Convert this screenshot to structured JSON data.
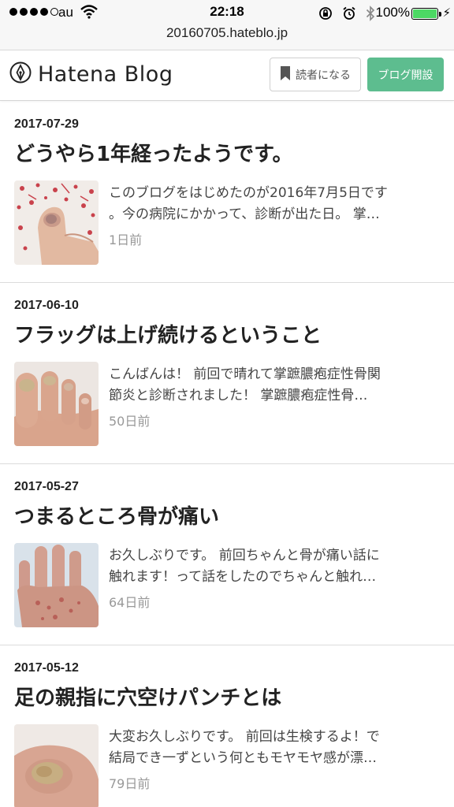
{
  "status_bar": {
    "carrier": "au",
    "time": "22:18",
    "battery_percent": "100%",
    "battery_level": 1.0,
    "battery_color": "#4cd964"
  },
  "browser": {
    "url": "20160705.hateblo.jp"
  },
  "header": {
    "logo_text": "Hatena Blog",
    "reader_button": "読者になる",
    "open_blog_button": "ブログ開設",
    "accent_color": "#5dbd8f"
  },
  "posts": [
    {
      "date": "2017-07-29",
      "title": "どうやら1年経ったようです。",
      "excerpt_line1": "このブログをはじめたのが2016年7月5日です",
      "excerpt_line2": "。今の病院にかかって、診断が出た日。 掌…",
      "ago": "1日前"
    },
    {
      "date": "2017-06-10",
      "title": "フラッグは上げ続けるということ",
      "excerpt_line1": "こんばんは！ 前回で晴れて掌蹠膿疱症性骨関",
      "excerpt_line2": "節炎と診断されました！ 掌蹠膿疱症性骨…",
      "ago": "50日前"
    },
    {
      "date": "2017-05-27",
      "title": "つまるところ骨が痛い",
      "excerpt_line1": "お久しぶりです。 前回ちゃんと骨が痛い話に",
      "excerpt_line2": "触れます！って話をしたのでちゃんと触れ…",
      "ago": "64日前"
    },
    {
      "date": "2017-05-12",
      "title": "足の親指に穴空けパンチとは",
      "excerpt_line1": "大変お久しぶりです。 前回は生検するよ！で",
      "excerpt_line2": "結局でき一ずという何ともモヤモヤ感が漂…",
      "ago": "79日前"
    }
  ]
}
